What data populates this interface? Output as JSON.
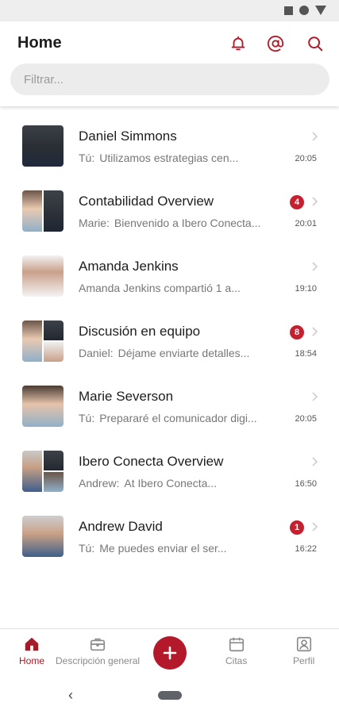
{
  "header": {
    "title": "Home",
    "search_placeholder": "Filtrar..."
  },
  "colors": {
    "accent": "#b3192a",
    "badge": "#c4202f",
    "muted_text": "#777777"
  },
  "icons": {
    "notifications": "bell-icon",
    "mentions": "at-icon",
    "search": "search-icon"
  },
  "chats": [
    {
      "name": "Daniel Simmons",
      "sender": "Tú:",
      "preview": "Utilizamos estrategias cen...",
      "time": "20:05",
      "badge": ""
    },
    {
      "name": "Contabilidad Overview",
      "sender": "Marie:",
      "preview": "Bienvenido a Ibero Conecta...",
      "time": "20:01",
      "badge": "4"
    },
    {
      "name": "Amanda Jenkins",
      "sender": "",
      "preview": "Amanda Jenkins compartió 1 a...",
      "time": "19:10",
      "badge": ""
    },
    {
      "name": "Discusión en equipo",
      "sender": "Daniel:",
      "preview": "Déjame enviarte detalles...",
      "time": "18:54",
      "badge": "8"
    },
    {
      "name": "Marie Severson",
      "sender": "Tú:",
      "preview": "Prepararé el comunicador digi...",
      "time": "20:05",
      "badge": ""
    },
    {
      "name": "Ibero Conecta Overview",
      "sender": "Andrew:",
      "preview": "At Ibero Conecta...",
      "time": "16:50",
      "badge": ""
    },
    {
      "name": "Andrew David",
      "sender": "Tú:",
      "preview": "Me puedes enviar el ser...",
      "time": "16:22",
      "badge": "1"
    }
  ],
  "bottom_nav": {
    "home": "Home",
    "overview": "Descripción general",
    "appointments": "Citas",
    "profile": "Perfil"
  }
}
